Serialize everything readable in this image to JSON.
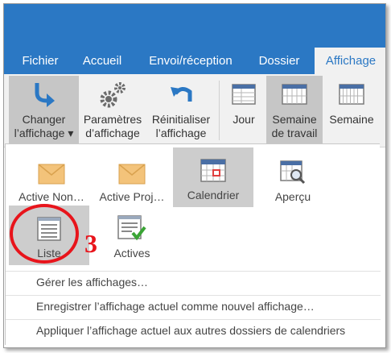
{
  "tabs": [
    {
      "label": "Fichier"
    },
    {
      "label": "Accueil"
    },
    {
      "label": "Envoi/réception"
    },
    {
      "label": "Dossier"
    },
    {
      "label": "Affichage"
    }
  ],
  "ribbon": {
    "change_view": {
      "line1": "Changer",
      "line2": "l’affichage ▾"
    },
    "view_settings": {
      "line1": "Paramètres",
      "line2": "d’affichage"
    },
    "reset_view": {
      "line1": "Réinitialiser",
      "line2": "l’affichage"
    },
    "day": {
      "line1": "Jour"
    },
    "work_week": {
      "line1": "Semaine",
      "line2": "de travail"
    },
    "week": {
      "line1": "Semaine"
    }
  },
  "views": [
    {
      "label": "Active Non…"
    },
    {
      "label": "Active Proj…"
    },
    {
      "label": "Calendrier"
    },
    {
      "label": "Aperçu"
    },
    {
      "label": "Liste"
    },
    {
      "label": "Actives"
    }
  ],
  "menu": [
    {
      "label": "Gérer les affichages…"
    },
    {
      "label": "Enregistrer l’affichage actuel comme nouvel affichage…"
    },
    {
      "label": "Appliquer l’affichage actuel aux autres dossiers de calendriers"
    }
  ],
  "callout": {
    "number": "3"
  },
  "colors": {
    "accent": "#2b78c4",
    "callout": "#e8141b",
    "check": "#3aa435",
    "envelope": "#f3c37a"
  }
}
